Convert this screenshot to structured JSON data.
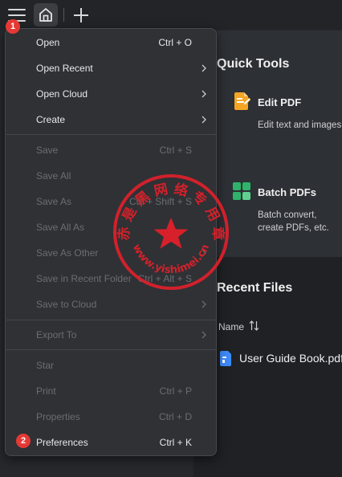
{
  "toolbar": {
    "menu_icon": "hamburger-icon",
    "home_icon": "home-icon",
    "add_icon": "plus-icon"
  },
  "quick_tools": {
    "title": "Quick Tools",
    "tools": [
      {
        "icon": "edit-pdf-icon",
        "title": "Edit PDF",
        "desc": "Edit text and images"
      },
      {
        "icon": "batch-pdfs-icon",
        "title": "Batch PDFs",
        "desc": "Batch convert, create PDFs, etc."
      }
    ]
  },
  "recent_files": {
    "title": "Recent Files",
    "sort_header": "Name",
    "sort_icon": "sort-arrows-icon",
    "files": [
      {
        "icon": "pdf-file-icon",
        "name": "User Guide Book.pdf"
      }
    ]
  },
  "menu": {
    "items": [
      {
        "label": "Open",
        "shortcut": "Ctrl + O",
        "enabled": true,
        "submenu": false
      },
      {
        "label": "Open Recent",
        "shortcut": "",
        "enabled": true,
        "submenu": true
      },
      {
        "label": "Open Cloud",
        "shortcut": "",
        "enabled": true,
        "submenu": true
      },
      {
        "label": "Create",
        "shortcut": "",
        "enabled": true,
        "submenu": true
      },
      {
        "label": "Save",
        "shortcut": "Ctrl + S",
        "enabled": false,
        "submenu": false
      },
      {
        "label": "Save All",
        "shortcut": "",
        "enabled": false,
        "submenu": false
      },
      {
        "label": "Save As",
        "shortcut": "Ctrl + Shift + S",
        "enabled": false,
        "submenu": false
      },
      {
        "label": "Save All As",
        "shortcut": "",
        "enabled": false,
        "submenu": false
      },
      {
        "label": "Save As Other",
        "shortcut": "",
        "enabled": false,
        "submenu": true
      },
      {
        "label": "Save in Recent Folder",
        "shortcut": "Ctrl + Alt + S",
        "enabled": false,
        "submenu": false
      },
      {
        "label": "Save to Cloud",
        "shortcut": "",
        "enabled": false,
        "submenu": true
      },
      {
        "label": "Export To",
        "shortcut": "",
        "enabled": false,
        "submenu": true
      },
      {
        "label": "Star",
        "shortcut": "",
        "enabled": false,
        "submenu": false
      },
      {
        "label": "Print",
        "shortcut": "Ctrl + P",
        "enabled": false,
        "submenu": false
      },
      {
        "label": "Properties",
        "shortcut": "Ctrl + D",
        "enabled": false,
        "submenu": false
      },
      {
        "label": "Preferences",
        "shortcut": "Ctrl + K",
        "enabled": true,
        "submenu": false
      }
    ]
  },
  "badges": [
    "1",
    "2"
  ],
  "watermark": {
    "text": "赤 是 黑 网 络 专 用 章",
    "url": "www.yishimei.cn"
  },
  "colors": {
    "badge_red": "#e53935",
    "stamp_red": "#e0202a",
    "edit_icon_orange": "#f5a524",
    "batch_icon_green": "#2fb36a",
    "file_icon_blue": "#3d8bfd"
  }
}
